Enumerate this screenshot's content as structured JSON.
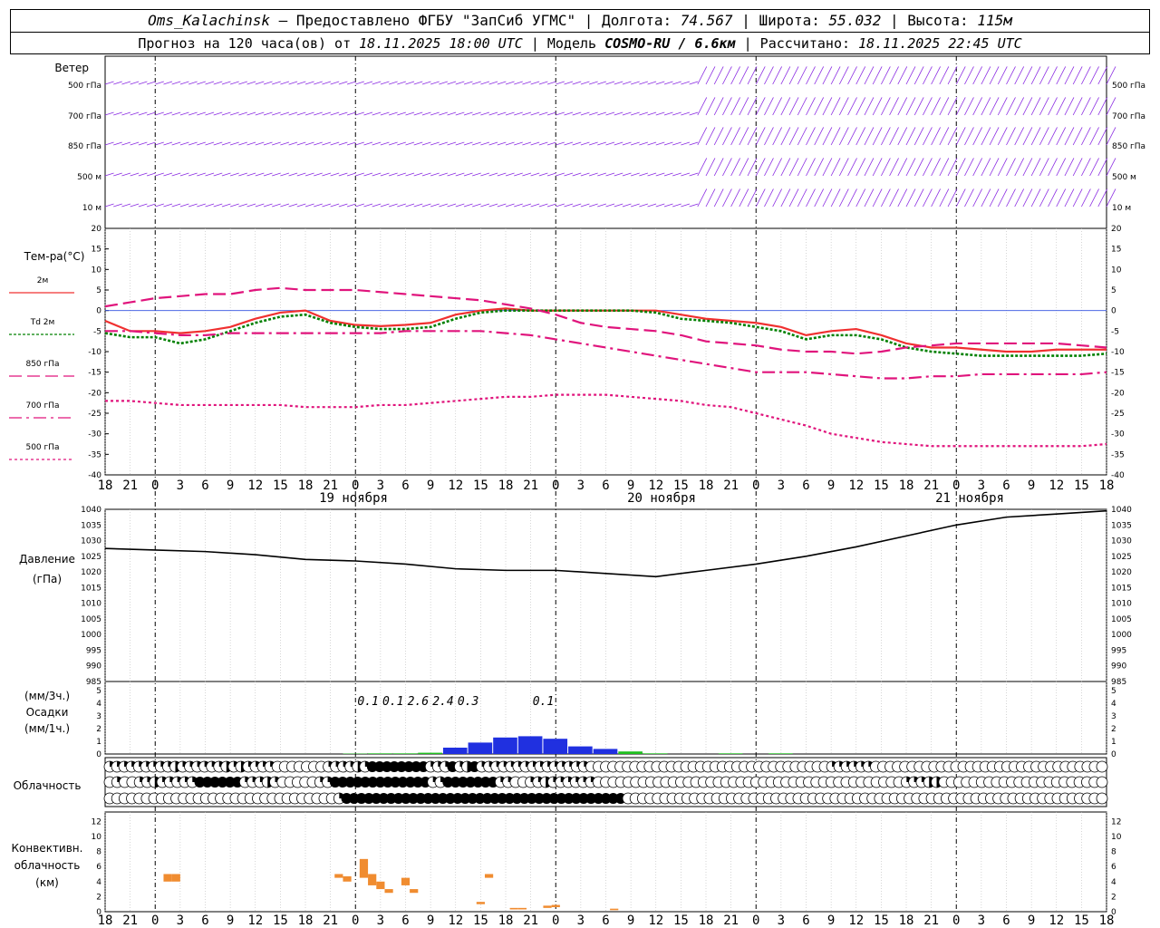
{
  "header": {
    "station": "Oms_Kalachinsk",
    "provider": "– Предоставлено ФГБУ \"ЗапСиб УГМС\" | Долгота:",
    "lon": "74.567",
    "lat_label": "| Широта:",
    "lat": "55.032",
    "alt_label": "| Высота:",
    "alt": "115м",
    "forecast_prefix": "Прогноз на 120 часа(ов) от",
    "forecast_time": "18.11.2025 18:00 UTC",
    "model_label": "| Модель",
    "model": "COSMO-RU / 6.6км",
    "calc_label": "| Рассчитано:",
    "calc_time": "18.11.2025 22:45 UTC"
  },
  "labels": {
    "wind_title": "Ветер",
    "wind_levels": [
      "500 гПа",
      "700 гПа",
      "850 гПа",
      "500 м",
      "10 м"
    ],
    "temp_title": "Тем-ра(°С)",
    "temp_legend": [
      "2м",
      "Td 2м",
      "850 гПа",
      "700 гПа",
      "500 гПа"
    ],
    "pressure_title": "Давление",
    "pressure_unit": "(гПа)",
    "precip_unit_3h": "(мм/3ч.)",
    "precip_title": "Осадки",
    "precip_unit_1h": "(мм/1ч.)",
    "cloud_title": "Облачность",
    "conv_title": [
      "Конвективн.",
      "облачность",
      "(км)"
    ],
    "days": [
      "19 ноября",
      "20 ноября",
      "21 ноября"
    ]
  },
  "colors": {
    "t2m": "#f03030",
    "td2m": "#008000",
    "t850": "#e0147c",
    "t700": "#e0147c",
    "t500": "#e0147c",
    "wind": "#8a2be2",
    "pressure": "#000000",
    "rain": "#2030e0",
    "rain_light": "#20c020",
    "conv": "#f08c30"
  },
  "chart_data": [
    {
      "type": "line",
      "title": "Тем-ра(°С)",
      "x_hours": [
        0,
        3,
        6,
        9,
        12,
        15,
        18,
        21,
        24,
        27,
        30,
        33,
        36,
        39,
        42,
        45,
        48,
        51,
        54,
        57,
        60,
        63,
        66,
        69,
        72,
        75,
        78,
        81,
        84,
        87,
        90,
        93,
        96,
        99,
        102,
        105,
        108,
        111,
        114,
        117,
        120
      ],
      "x_tick_labels": [
        "18",
        "21",
        "0",
        "3",
        "6",
        "9",
        "12",
        "15",
        "18",
        "21",
        "0",
        "3",
        "6",
        "9",
        "12",
        "15",
        "18",
        "21",
        "0",
        "3",
        "6",
        "9",
        "12",
        "15",
        "18",
        "21",
        "0",
        "3",
        "6",
        "9",
        "12",
        "15",
        "18",
        "21",
        "0",
        "3",
        "6",
        "9",
        "12",
        "15",
        "18",
        "21",
        "0"
      ],
      "ylim": [
        -40,
        20
      ],
      "series": [
        {
          "name": "2м",
          "values": [
            -2.5,
            -5,
            -5,
            -5.5,
            -5,
            -4,
            -2,
            -0.5,
            0,
            -2.5,
            -3.5,
            -3.8,
            -3.5,
            -3,
            -1,
            0,
            0.5,
            0,
            0,
            0,
            0,
            0,
            0,
            -1,
            -2,
            -2.5,
            -3,
            -4,
            -6,
            -5,
            -4.5,
            -6,
            -8,
            -9,
            -9,
            -9.5,
            -10,
            -10,
            -9.5,
            -9.5,
            -9.5
          ]
        },
        {
          "name": "Td 2м",
          "values": [
            -5.5,
            -6.5,
            -6.5,
            -8,
            -7,
            -5,
            -3,
            -1.5,
            -1,
            -3,
            -4,
            -4.5,
            -4.5,
            -4,
            -2,
            -0.5,
            0,
            0,
            0,
            0,
            0,
            0,
            -0.5,
            -2,
            -2.5,
            -3,
            -4,
            -5,
            -7,
            -6,
            -6,
            -7,
            -9,
            -10,
            -10.5,
            -11,
            -11,
            -11,
            -11,
            -11,
            -10.5
          ]
        },
        {
          "name": "850 гПа",
          "values": [
            1,
            2,
            3,
            3.5,
            4,
            4,
            5,
            5.5,
            5,
            5,
            5,
            4.5,
            4,
            3.5,
            3,
            2.5,
            1.5,
            0.5,
            -1,
            -3,
            -4,
            -4.5,
            -5,
            -6,
            -7.5,
            -8,
            -8.5,
            -9.5,
            -10,
            -10,
            -10.5,
            -10,
            -9,
            -8.5,
            -8,
            -8,
            -8,
            -8,
            -8,
            -8.5,
            -9
          ]
        },
        {
          "name": "700 гПа",
          "values": [
            -5,
            -5,
            -5.5,
            -6,
            -6,
            -5.5,
            -5.5,
            -5.5,
            -5.5,
            -5.5,
            -5.5,
            -5.5,
            -5,
            -5,
            -5,
            -5,
            -5.5,
            -6,
            -7,
            -8,
            -9,
            -10,
            -11,
            -12,
            -13,
            -14,
            -15,
            -15,
            -15,
            -15.5,
            -16,
            -16.5,
            -16.5,
            -16,
            -16,
            -15.5,
            -15.5,
            -15.5,
            -15.5,
            -15.5,
            -15
          ]
        },
        {
          "name": "500 гПа",
          "values": [
            -22,
            -22,
            -22.5,
            -23,
            -23,
            -23,
            -23,
            -23,
            -23.5,
            -23.5,
            -23.5,
            -23,
            -23,
            -22.5,
            -22,
            -21.5,
            -21,
            -21,
            -20.5,
            -20.5,
            -20.5,
            -21,
            -21.5,
            -22,
            -23,
            -23.5,
            -25,
            -26.5,
            -28,
            -30,
            -31,
            -32,
            -32.5,
            -33,
            -33,
            -33,
            -33,
            -33,
            -33,
            -33,
            -32.5
          ]
        }
      ]
    },
    {
      "type": "line",
      "title": "Давление",
      "ylabel": "(гПа)",
      "ylim": [
        985,
        1040
      ],
      "x_hours": [
        0,
        6,
        12,
        18,
        24,
        30,
        36,
        42,
        48,
        54,
        60,
        66,
        72,
        78,
        84,
        90,
        96,
        102,
        108,
        114,
        120
      ],
      "series": [
        {
          "name": "",
          "values": [
            1027.5,
            1027,
            1026.5,
            1025.5,
            1024,
            1023.5,
            1022.5,
            1021,
            1020.5,
            1020.5,
            1019.5,
            1018.5,
            1020.5,
            1022.5,
            1025,
            1028,
            1031.5,
            1035,
            1037.5,
            1038.5,
            1039.5
          ]
        }
      ]
    },
    {
      "type": "bar",
      "title": "Осадки",
      "ylabel": "(мм/1ч.)",
      "ylim": [
        0,
        5
      ],
      "x_hours": [
        30,
        33,
        36,
        39,
        42,
        45,
        48,
        51,
        54,
        57,
        60,
        63,
        66,
        69,
        72,
        75,
        78,
        81
      ],
      "values": [
        0.03,
        0.05,
        0.05,
        0.1,
        0.5,
        0.9,
        1.3,
        1.4,
        1.2,
        0.6,
        0.4,
        0.2,
        0.05,
        0,
        0,
        0.05,
        0,
        0.05
      ],
      "annotations": [
        {
          "x_hours": 31.5,
          "text": "0.1"
        },
        {
          "x_hours": 34.5,
          "text": "0.1"
        },
        {
          "x_hours": 37.5,
          "text": "2.6"
        },
        {
          "x_hours": 40.5,
          "text": "2.4"
        },
        {
          "x_hours": 43.5,
          "text": "0.3"
        },
        {
          "x_hours": 52.5,
          "text": "0.1"
        }
      ]
    },
    {
      "type": "bar",
      "title": "Конвективн. облачность",
      "ylabel": "(км)",
      "ylim": [
        0,
        13
      ],
      "segments": [
        {
          "x_hours": 7.5,
          "bottom": 4,
          "top": 5
        },
        {
          "x_hours": 8.5,
          "bottom": 4,
          "top": 5
        },
        {
          "x_hours": 28,
          "bottom": 4.5,
          "top": 5
        },
        {
          "x_hours": 29,
          "bottom": 4,
          "top": 4.7
        },
        {
          "x_hours": 31,
          "bottom": 4.5,
          "top": 7
        },
        {
          "x_hours": 32,
          "bottom": 3.5,
          "top": 5
        },
        {
          "x_hours": 33,
          "bottom": 3,
          "top": 4
        },
        {
          "x_hours": 34,
          "bottom": 2.5,
          "top": 3
        },
        {
          "x_hours": 36,
          "bottom": 3.5,
          "top": 4.5
        },
        {
          "x_hours": 37,
          "bottom": 2.5,
          "top": 3
        },
        {
          "x_hours": 45,
          "bottom": 1,
          "top": 1.3
        },
        {
          "x_hours": 46,
          "bottom": 4.5,
          "top": 5
        },
        {
          "x_hours": 49,
          "bottom": 0.3,
          "top": 0.5
        },
        {
          "x_hours": 50,
          "bottom": 0.3,
          "top": 0.5
        },
        {
          "x_hours": 53,
          "bottom": 0.5,
          "top": 0.8
        },
        {
          "x_hours": 54,
          "bottom": 0.6,
          "top": 0.9
        },
        {
          "x_hours": 61,
          "bottom": 0.2,
          "top": 0.4
        }
      ]
    }
  ],
  "cloud_rows": {
    "low": "qqqqqqqqqhqqqqqqhqhqqqqoooooooqqqqhqffffffffqqqfqhfqqqqqqqqqqqqqqqoooooooooooooooooooooooooooooooooqqqqqqoooooooooooooooooooooooooooooooo",
    "mid": "oqooqqhqqqqqffffffqqqhqoooooqqfffffffffffffqqfffffffqqooqqhqqqqqqoooooooooooooooooooooooooooooooooooooooooqqqhhoooooooooooooooooooooo",
    "high": "oooooooooooooooooooooooooooooooqffffffffffffffffffffffffffffffffffffffooooooooooooooooooooooooooooooooooooooooooooooooooooooooooooooooo"
  }
}
